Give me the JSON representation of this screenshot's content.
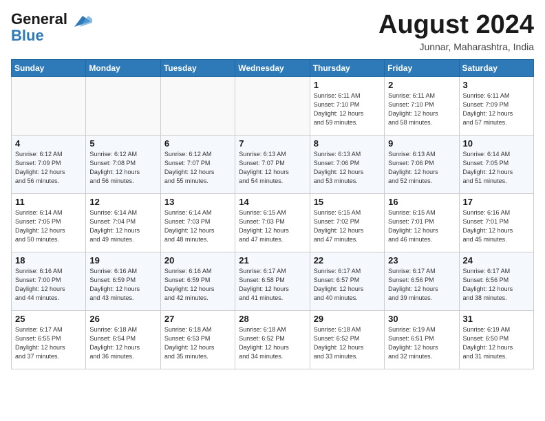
{
  "header": {
    "logo_line1": "General",
    "logo_line2": "Blue",
    "month_title": "August 2024",
    "subtitle": "Junnar, Maharashtra, India"
  },
  "weekdays": [
    "Sunday",
    "Monday",
    "Tuesday",
    "Wednesday",
    "Thursday",
    "Friday",
    "Saturday"
  ],
  "weeks": [
    [
      {
        "day": "",
        "info": ""
      },
      {
        "day": "",
        "info": ""
      },
      {
        "day": "",
        "info": ""
      },
      {
        "day": "",
        "info": ""
      },
      {
        "day": "1",
        "info": "Sunrise: 6:11 AM\nSunset: 7:10 PM\nDaylight: 12 hours\nand 59 minutes."
      },
      {
        "day": "2",
        "info": "Sunrise: 6:11 AM\nSunset: 7:10 PM\nDaylight: 12 hours\nand 58 minutes."
      },
      {
        "day": "3",
        "info": "Sunrise: 6:11 AM\nSunset: 7:09 PM\nDaylight: 12 hours\nand 57 minutes."
      }
    ],
    [
      {
        "day": "4",
        "info": "Sunrise: 6:12 AM\nSunset: 7:09 PM\nDaylight: 12 hours\nand 56 minutes."
      },
      {
        "day": "5",
        "info": "Sunrise: 6:12 AM\nSunset: 7:08 PM\nDaylight: 12 hours\nand 56 minutes."
      },
      {
        "day": "6",
        "info": "Sunrise: 6:12 AM\nSunset: 7:07 PM\nDaylight: 12 hours\nand 55 minutes."
      },
      {
        "day": "7",
        "info": "Sunrise: 6:13 AM\nSunset: 7:07 PM\nDaylight: 12 hours\nand 54 minutes."
      },
      {
        "day": "8",
        "info": "Sunrise: 6:13 AM\nSunset: 7:06 PM\nDaylight: 12 hours\nand 53 minutes."
      },
      {
        "day": "9",
        "info": "Sunrise: 6:13 AM\nSunset: 7:06 PM\nDaylight: 12 hours\nand 52 minutes."
      },
      {
        "day": "10",
        "info": "Sunrise: 6:14 AM\nSunset: 7:05 PM\nDaylight: 12 hours\nand 51 minutes."
      }
    ],
    [
      {
        "day": "11",
        "info": "Sunrise: 6:14 AM\nSunset: 7:05 PM\nDaylight: 12 hours\nand 50 minutes."
      },
      {
        "day": "12",
        "info": "Sunrise: 6:14 AM\nSunset: 7:04 PM\nDaylight: 12 hours\nand 49 minutes."
      },
      {
        "day": "13",
        "info": "Sunrise: 6:14 AM\nSunset: 7:03 PM\nDaylight: 12 hours\nand 48 minutes."
      },
      {
        "day": "14",
        "info": "Sunrise: 6:15 AM\nSunset: 7:03 PM\nDaylight: 12 hours\nand 47 minutes."
      },
      {
        "day": "15",
        "info": "Sunrise: 6:15 AM\nSunset: 7:02 PM\nDaylight: 12 hours\nand 47 minutes."
      },
      {
        "day": "16",
        "info": "Sunrise: 6:15 AM\nSunset: 7:01 PM\nDaylight: 12 hours\nand 46 minutes."
      },
      {
        "day": "17",
        "info": "Sunrise: 6:16 AM\nSunset: 7:01 PM\nDaylight: 12 hours\nand 45 minutes."
      }
    ],
    [
      {
        "day": "18",
        "info": "Sunrise: 6:16 AM\nSunset: 7:00 PM\nDaylight: 12 hours\nand 44 minutes."
      },
      {
        "day": "19",
        "info": "Sunrise: 6:16 AM\nSunset: 6:59 PM\nDaylight: 12 hours\nand 43 minutes."
      },
      {
        "day": "20",
        "info": "Sunrise: 6:16 AM\nSunset: 6:59 PM\nDaylight: 12 hours\nand 42 minutes."
      },
      {
        "day": "21",
        "info": "Sunrise: 6:17 AM\nSunset: 6:58 PM\nDaylight: 12 hours\nand 41 minutes."
      },
      {
        "day": "22",
        "info": "Sunrise: 6:17 AM\nSunset: 6:57 PM\nDaylight: 12 hours\nand 40 minutes."
      },
      {
        "day": "23",
        "info": "Sunrise: 6:17 AM\nSunset: 6:56 PM\nDaylight: 12 hours\nand 39 minutes."
      },
      {
        "day": "24",
        "info": "Sunrise: 6:17 AM\nSunset: 6:56 PM\nDaylight: 12 hours\nand 38 minutes."
      }
    ],
    [
      {
        "day": "25",
        "info": "Sunrise: 6:17 AM\nSunset: 6:55 PM\nDaylight: 12 hours\nand 37 minutes."
      },
      {
        "day": "26",
        "info": "Sunrise: 6:18 AM\nSunset: 6:54 PM\nDaylight: 12 hours\nand 36 minutes."
      },
      {
        "day": "27",
        "info": "Sunrise: 6:18 AM\nSunset: 6:53 PM\nDaylight: 12 hours\nand 35 minutes."
      },
      {
        "day": "28",
        "info": "Sunrise: 6:18 AM\nSunset: 6:52 PM\nDaylight: 12 hours\nand 34 minutes."
      },
      {
        "day": "29",
        "info": "Sunrise: 6:18 AM\nSunset: 6:52 PM\nDaylight: 12 hours\nand 33 minutes."
      },
      {
        "day": "30",
        "info": "Sunrise: 6:19 AM\nSunset: 6:51 PM\nDaylight: 12 hours\nand 32 minutes."
      },
      {
        "day": "31",
        "info": "Sunrise: 6:19 AM\nSunset: 6:50 PM\nDaylight: 12 hours\nand 31 minutes."
      }
    ]
  ]
}
